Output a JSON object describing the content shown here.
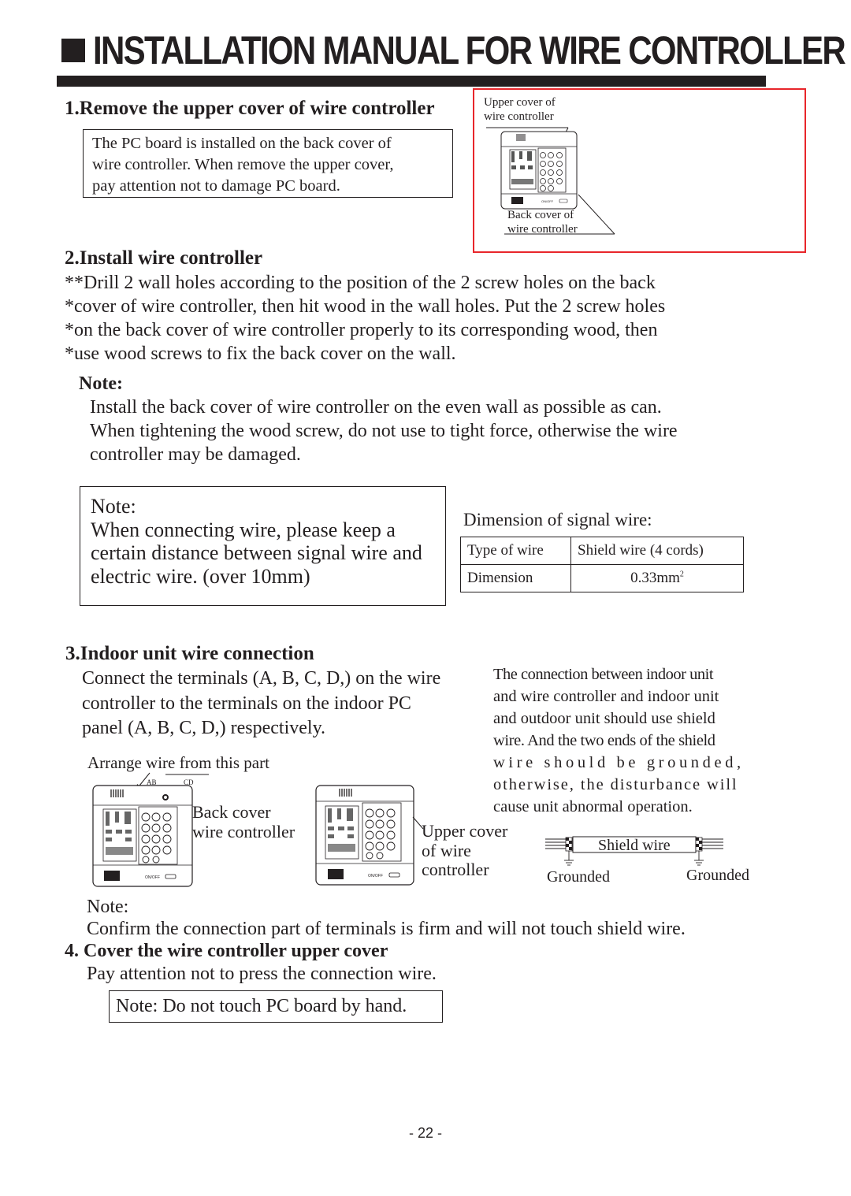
{
  "header": {
    "title": "INSTALLATION MANUAL FOR WIRE CONTROLLER",
    "title_bullet_icon": "black-square"
  },
  "section1": {
    "heading": "1.Remove the upper cover of wire controller",
    "box_lines": [
      "The PC board is installed on the back cover of",
      "wire controller. When remove the upper cover,",
      "pay attention not to damage PC board."
    ],
    "figure": {
      "upper_label": [
        "Upper cover of",
        "wire controller"
      ],
      "back_label": [
        "Back cover of",
        "wire controller"
      ],
      "border_color": "#e8262b",
      "onoff_label": "ON/OFF"
    }
  },
  "section2": {
    "heading": "2.Install wire controller",
    "lines": [
      "**Drill 2 wall holes according to the position of the 2 screw holes on the back",
      "*cover of wire controller, then hit wood in the wall holes. Put the 2 screw holes",
      "*on the back cover of wire controller properly to its corresponding wood, then",
      "*use wood screws to fix the back cover on the wall."
    ],
    "note_heading": "Note:",
    "note_lines": [
      "Install the back cover of wire controller on the even wall as possible as can.",
      "When tightening the wood screw, do not use to tight force, otherwise the wire",
      "controller may be damaged."
    ]
  },
  "wire_note": {
    "heading": "Note:",
    "lines": [
      "When connecting wire, please keep a",
      "certain distance between signal wire and",
      "electric wire. (over 10mm)"
    ]
  },
  "signal_wire": {
    "caption": "Dimension of signal wire:",
    "rows": [
      {
        "label": "Type of wire",
        "value": "Shield wire (4 cords)"
      },
      {
        "label": "Dimension",
        "value": "0.33mm",
        "superscript": "2"
      }
    ]
  },
  "section3": {
    "heading": "3.Indoor unit wire connection",
    "lines": [
      "Connect the terminals (A, B, C, D,) on the wire",
      "controller to the terminals on the indoor PC",
      "panel (A, B, C, D,) respectively."
    ],
    "arrange_label": "Arrange wire from this part",
    "terminal_labels": [
      "AB",
      "CD"
    ],
    "back_cover_label": [
      "Back cover",
      "wire controller"
    ],
    "upper_cover_label": [
      "Upper cover",
      "of wire",
      "controller"
    ],
    "side_text": [
      "The connection between indoor unit",
      "and wire controller and indoor unit",
      "and outdoor unit should use shield",
      "wire. And the two ends of the shield",
      "wire should be grounded,",
      "otherwise, the disturbance will",
      "cause unit abnormal operation."
    ],
    "shield_diagram": {
      "wire_label": "Shield wire",
      "left_ground": "Grounded",
      "right_ground": "Grounded"
    },
    "note_heading": "Note:",
    "note_text": "Confirm the connection part of terminals is firm and will not touch shield wire."
  },
  "section4": {
    "heading": "4. Cover the wire controller upper cover",
    "text": "Pay attention not to press the connection wire.",
    "box_note": "Note: Do not touch PC board by hand."
  },
  "footer": {
    "page_number": "- 22 -"
  }
}
